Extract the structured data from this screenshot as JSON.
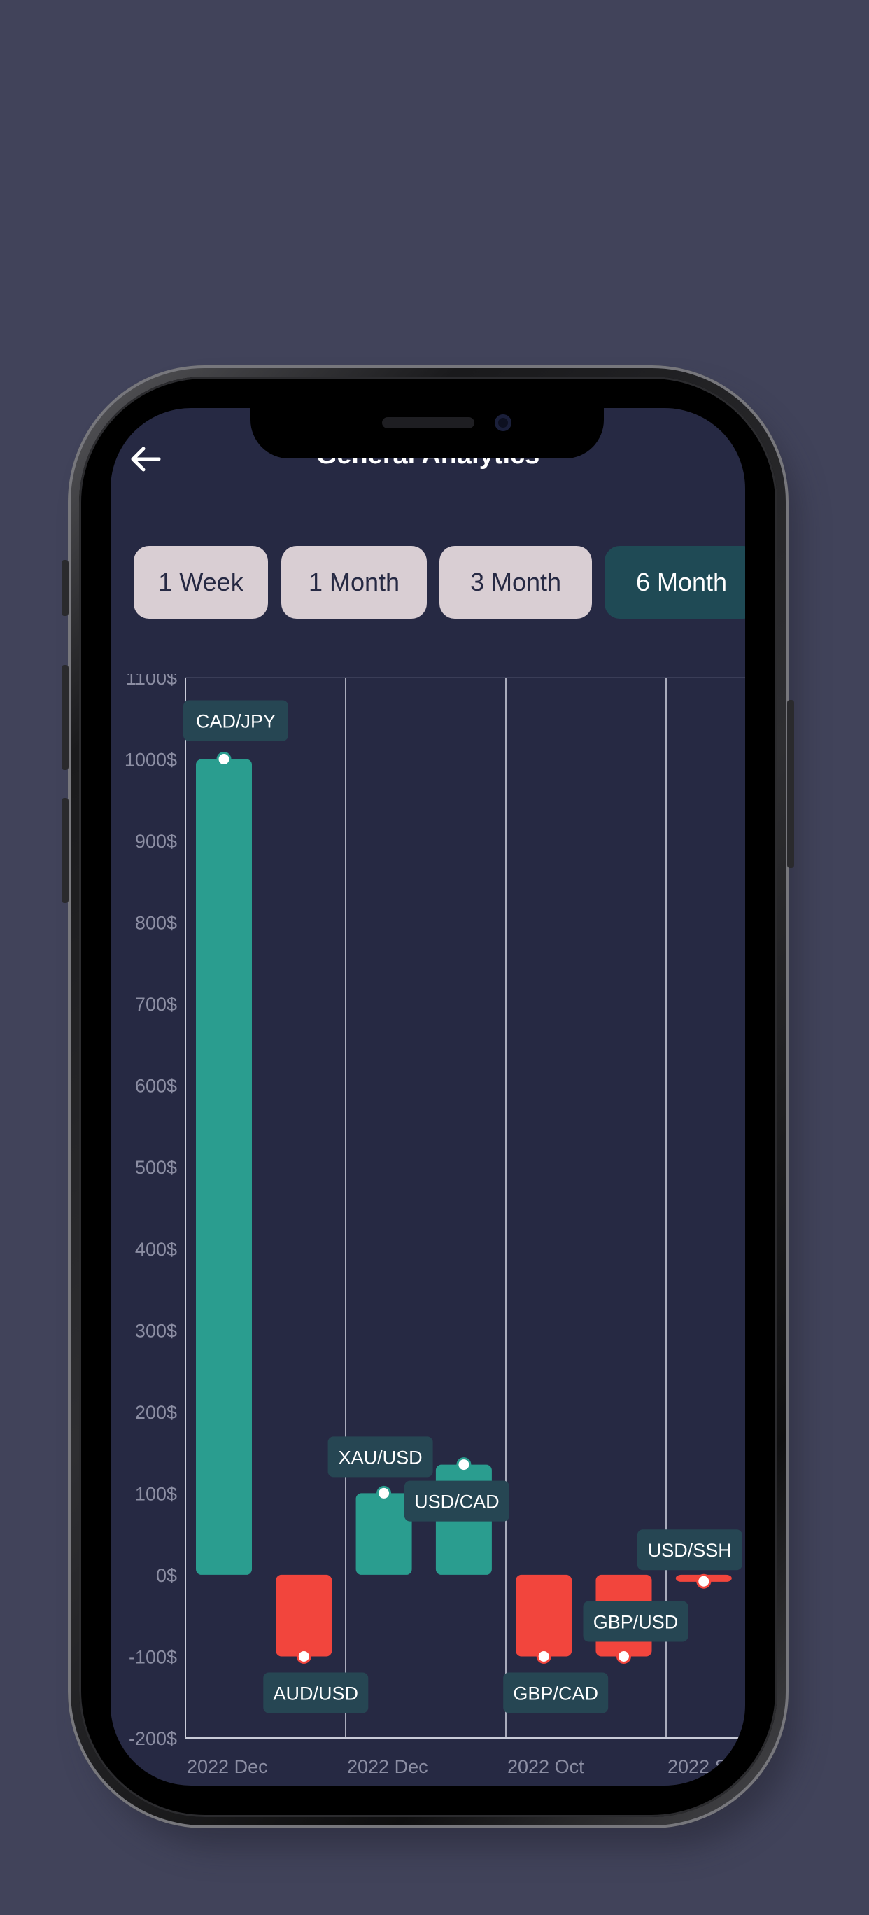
{
  "header": {
    "title": "General Analytics",
    "back_icon": "arrow-left-icon"
  },
  "filters": [
    {
      "label": "1 Week",
      "active": false
    },
    {
      "label": "1 Month",
      "active": false
    },
    {
      "label": "3 Month",
      "active": false
    },
    {
      "label": "6 Month",
      "active": true
    }
  ],
  "colors": {
    "positive": "#2a9d8f",
    "negative": "#f2453d",
    "label_bg": "#264653",
    "screen_bg": "#262943"
  },
  "chart_data": {
    "type": "bar",
    "ylim": [
      -200,
      1100
    ],
    "yticks": [
      1100,
      1000,
      900,
      800,
      700,
      600,
      500,
      400,
      300,
      200,
      100,
      0,
      -100,
      -200
    ],
    "ytick_suffix": "$",
    "xticks": [
      "2022 Dec",
      "2022 Dec",
      "2022 Oct",
      "2022 S"
    ],
    "bars": [
      {
        "name": "CAD/JPY",
        "value": 1000
      },
      {
        "name": "AUD/USD",
        "value": -100
      },
      {
        "name": "XAU/USD",
        "value": 100
      },
      {
        "name": "USD/CAD",
        "value": 135
      },
      {
        "name": "GBP/CAD",
        "value": -100
      },
      {
        "name": "GBP/USD",
        "value": -100
      },
      {
        "name": "USD/SSH",
        "value": -8
      }
    ]
  }
}
